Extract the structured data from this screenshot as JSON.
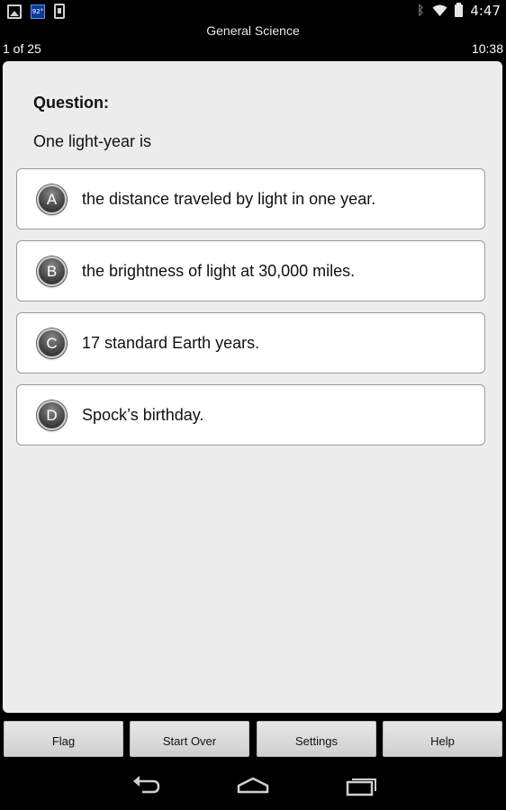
{
  "status_bar": {
    "left_icons": [
      "gallery-icon",
      "weather-icon",
      "download-icon"
    ],
    "weather_text": "92°",
    "right_icons": [
      "bluetooth-icon",
      "wifi-icon",
      "battery-icon"
    ],
    "time": "4:47"
  },
  "header": {
    "title": "General Science",
    "progress": "1 of 25",
    "timer": "10:38"
  },
  "question": {
    "heading": "Question:",
    "text": "One light-year is"
  },
  "answers": [
    {
      "letter": "A",
      "text": "the distance traveled by light in one year."
    },
    {
      "letter": "B",
      "text": "the brightness of light at 30,000 miles."
    },
    {
      "letter": "C",
      "text": "17 standard Earth years."
    },
    {
      "letter": "D",
      "text": "Spock’s birthday."
    }
  ],
  "bottom_buttons": {
    "flag": "Flag",
    "start_over": "Start Over",
    "settings": "Settings",
    "help": "Help"
  },
  "nav_bar": {
    "icons": [
      "back-icon",
      "home-icon",
      "recent-apps-icon"
    ]
  },
  "colors": {
    "background": "#000000",
    "card": "#ececec",
    "answer_background": "#ffffff",
    "badge": "#4a4a4a",
    "weather_icon": "#0b3a9e"
  }
}
